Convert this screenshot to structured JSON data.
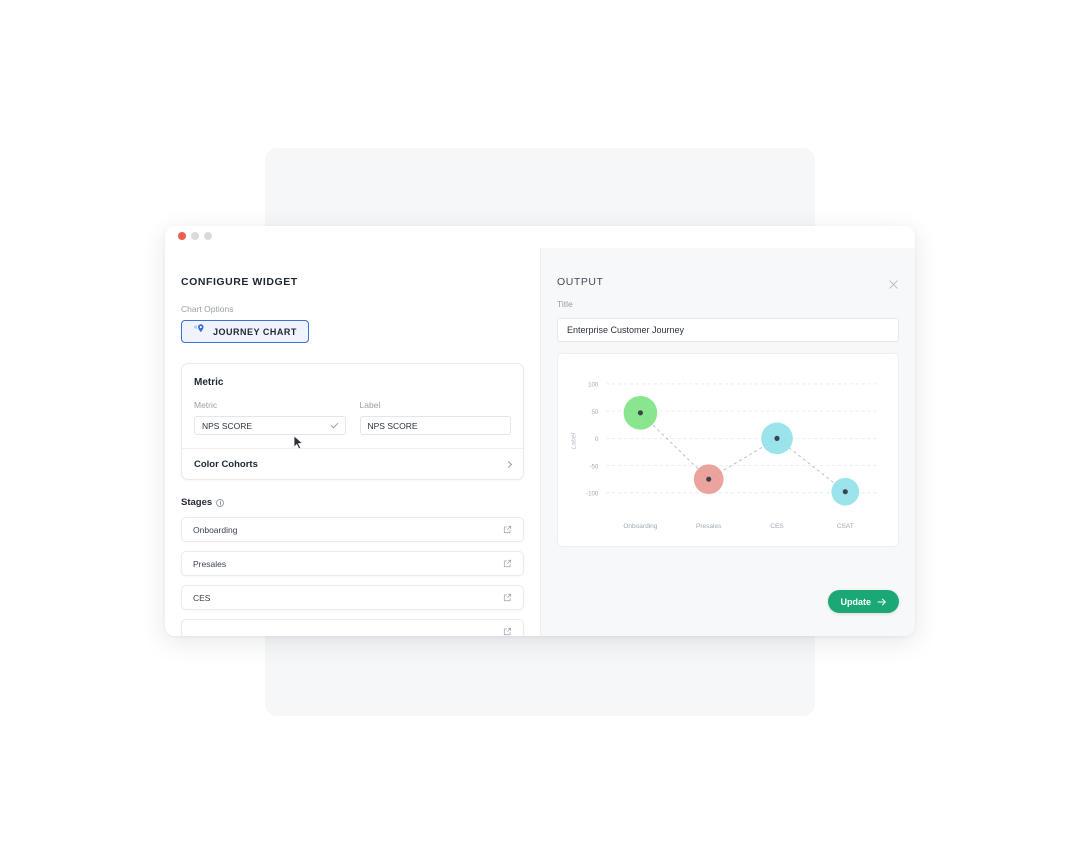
{
  "window": {
    "dots": [
      "close",
      "minimize",
      "maximize"
    ],
    "dot_colors": {
      "close": "#e8604c",
      "minimize": "#d8dade",
      "maximize": "#d8dade"
    }
  },
  "left_panel": {
    "heading": "CONFIGURE WIDGET",
    "chart_options_label": "Chart Options",
    "chart_option_button": {
      "label": "JOURNEY CHART",
      "icon": "journey-pin-icon",
      "selected": true,
      "accent": "#3b6fd4",
      "fill": "#eef3fd"
    },
    "metric_card": {
      "heading": "Metric",
      "metric_field_label": "Metric",
      "metric_value": "NPS SCORE",
      "label_field_label": "Label",
      "label_value": "NPS SCORE",
      "color_cohorts_label": "Color Cohorts"
    },
    "stages": {
      "heading": "Stages",
      "items": [
        {
          "name": "Onboarding"
        },
        {
          "name": "Presales"
        },
        {
          "name": "CES"
        },
        {
          "name": ""
        }
      ]
    }
  },
  "right_panel": {
    "heading": "OUTPUT",
    "close_icon": "close-icon",
    "title_field_label": "Title",
    "title_value": "Enterprise Customer Journey",
    "update_button": {
      "label": "Update",
      "icon": "arrow-right-icon",
      "color": "#1aa876"
    }
  },
  "chart_data": {
    "type": "scatter",
    "title": "",
    "xlabel": "",
    "ylabel": "Label",
    "categories": [
      "Onboarding",
      "Presales",
      "CES",
      "CSAT"
    ],
    "values": [
      47,
      -75,
      0,
      -98
    ],
    "bubble_sizes": [
      34,
      30,
      32,
      28
    ],
    "point_colors": [
      "#74e07a",
      "#e8948c",
      "#89dfe8",
      "#89dfe8"
    ],
    "marker_color": "#3d4450",
    "connector": "dashed",
    "connector_color": "#9aa1ab",
    "ylim": [
      -125,
      115
    ],
    "yticks": [
      100,
      50,
      0,
      -50,
      -100
    ],
    "ytick_labels": [
      "100",
      "50",
      "0",
      "-50",
      "-100"
    ],
    "grid": true,
    "grid_style": "dashed",
    "legend": "none"
  }
}
